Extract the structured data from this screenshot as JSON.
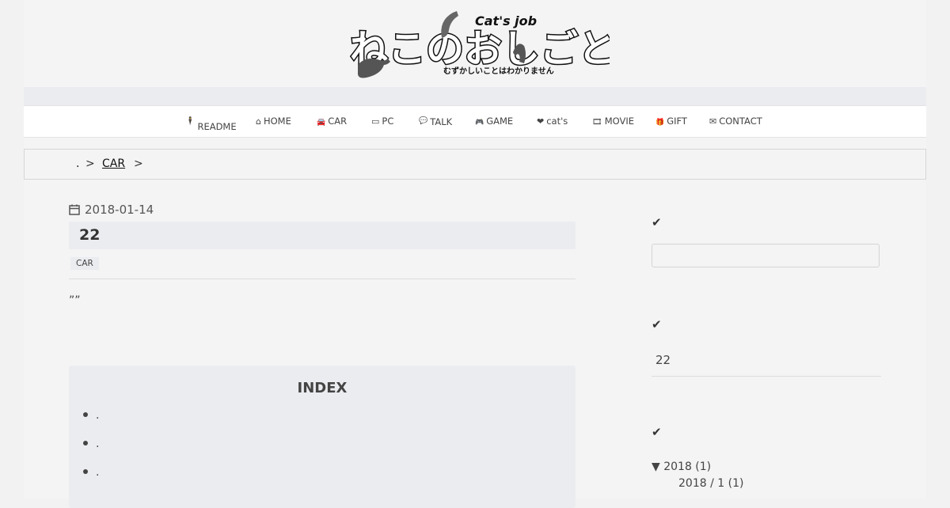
{
  "header": {
    "logo_main": "ねこのおしごと",
    "logo_en": "Cat's job",
    "logo_sub": "むずかしいことはわかりません"
  },
  "nav": [
    {
      "label": "README",
      "icon": "person-icon",
      "glyph": "🕴"
    },
    {
      "label": "HOME",
      "icon": "home-icon",
      "glyph": "⌂"
    },
    {
      "label": "CAR",
      "icon": "car-icon",
      "glyph": "🚘"
    },
    {
      "label": "PC",
      "icon": "desktop-icon",
      "glyph": "▭"
    },
    {
      "label": "TALK",
      "icon": "comment-icon",
      "glyph": "💬"
    },
    {
      "label": "GAME",
      "icon": "gamepad-icon",
      "glyph": "🎮"
    },
    {
      "label": "cat's",
      "icon": "heart-icon",
      "glyph": "❤"
    },
    {
      "label": "MOVIE",
      "icon": "film-icon",
      "glyph": "🎞"
    },
    {
      "label": "GIFT",
      "icon": "gift-icon",
      "glyph": "🎁"
    },
    {
      "label": "CONTACT",
      "icon": "envelope-icon",
      "glyph": "✉"
    }
  ],
  "breadcrumb": {
    "home": ".",
    "sep1": ">",
    "category": "CAR",
    "sep2": ">"
  },
  "post": {
    "date": "2018-01-14",
    "title": "22",
    "tag": "CAR",
    "excerpt": "””"
  },
  "index": {
    "title": "INDEX",
    "items": [
      ".",
      ".",
      "."
    ]
  },
  "sidebar": {
    "check_glyph": "✔",
    "recent_post": "22",
    "archive_year": "▼ 2018 (1)",
    "archive_month": "2018 / 1 (1)"
  },
  "colors": {
    "background": "#f4f4f4",
    "band": "#ebecef",
    "text": "#333333"
  }
}
